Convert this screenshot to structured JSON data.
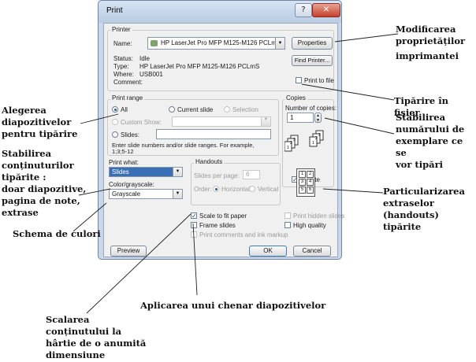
{
  "dialog": {
    "title": "Print",
    "help_glyph": "?",
    "close_glyph": "✕",
    "printer": {
      "group": "Printer",
      "name_label": "Name:",
      "name_value": "HP LaserJet Pro MFP M125-M126 PCLmS",
      "properties": "Properties",
      "status_label": "Status:",
      "status_value": "Idle",
      "type_label": "Type:",
      "type_value": "HP LaserJet Pro MFP M125-M126 PCLmS",
      "where_label": "Where:",
      "where_value": "USB001",
      "comment_label": "Comment:",
      "find_printer": "Find Printer...",
      "print_to_file": "Print to file"
    },
    "range": {
      "group": "Print range",
      "all": "All",
      "current_slide": "Current slide",
      "selection": "Selection",
      "custom_show": "Custom Show:",
      "slides": "Slides:",
      "hint1": "Enter slide numbers and/or slide ranges. For example,",
      "hint2": "1;3;5-12"
    },
    "copies": {
      "group": "Copies",
      "number_label": "Number of copies:",
      "number_value": "1",
      "collate": "Collate"
    },
    "print_what": {
      "label": "Print what:",
      "value": "Slides"
    },
    "color": {
      "label": "Color/grayscale:",
      "value": "Grayscale"
    },
    "handouts": {
      "group": "Handouts",
      "slides_per_page": "Slides per page:",
      "spp_value": "6",
      "order": "Order:",
      "horizontal": "Horizontal",
      "vertical": "Vertical",
      "grid": [
        "1",
        "2",
        "3",
        "4",
        "5",
        "6"
      ]
    },
    "options": {
      "scale": "Scale to fit paper",
      "frame": "Frame slides",
      "comments": "Print comments and ink markup",
      "hidden": "Print hidden slides",
      "quality": "High quality"
    },
    "preview": "Preview",
    "ok": "OK",
    "cancel": "Cancel"
  },
  "annotations": {
    "properties": [
      "Modificarea",
      "proprietăților",
      "imprimantei"
    ],
    "print_to_file": "Tipărire în fișier",
    "copies": [
      "Stabilirea",
      "numărului de",
      "exemplare ce se",
      "vor tipări"
    ],
    "range": [
      "Alegerea",
      "diapozitivelor",
      "pentru tipărire"
    ],
    "content": [
      "Stabilirea",
      "conținuturilor",
      "tipărite :",
      "doar diapozitive,",
      "pagina de note,",
      "extrase"
    ],
    "handouts": [
      "Particularizarea",
      "extraselor",
      "(handouts)",
      "tipărite"
    ],
    "color": "Schema de culori",
    "frame": "Aplicarea unui chenar diapozitivelor",
    "scale": [
      "Scalarea",
      "conținutului la",
      "hârtie de o anumită",
      "dimensiune"
    ]
  }
}
